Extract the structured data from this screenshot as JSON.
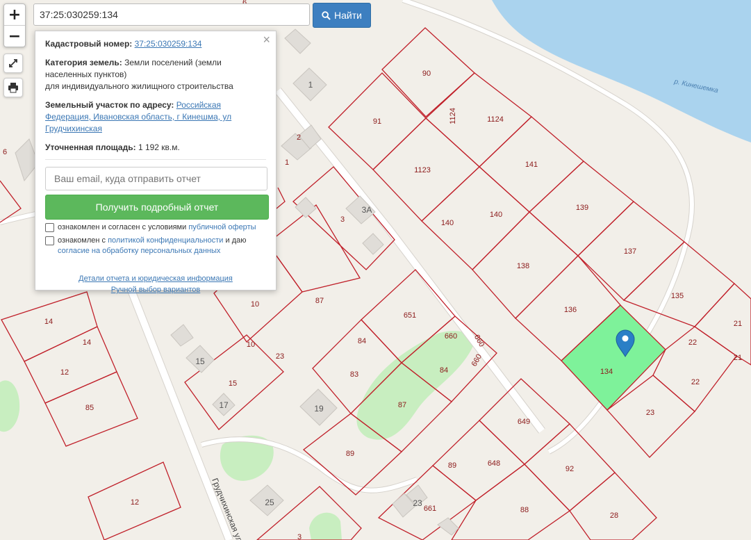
{
  "search": {
    "value": "37:25:030259:134",
    "button_label": "Найти"
  },
  "zoom": {
    "in_label": "+",
    "out_label": "−"
  },
  "popup": {
    "cadastral_label": "Кадастровый номер:",
    "cadastral_value": "37:25:030259:134",
    "category_label": "Категория земель:",
    "category_value_1": "Земли поселений (земли",
    "category_value_2": "населенных пунктов)",
    "category_value_3": "для индивидуального жилищного строительства",
    "address_label": "Земельный участок по адресу:",
    "address_value_1": "Российская",
    "address_value_2": "Федерация, Ивановская область, г Кинешма, ул",
    "address_value_3": "Грудчихинская",
    "area_label": "Уточненная площадь:",
    "area_value": "1 192 кв.м.",
    "email_placeholder": "Ваш email, куда отправить отчет",
    "report_button": "Получить подробный отчет",
    "consent1_pre": "ознакомлен и согласен с условиями",
    "consent1_link": "публичной оферты",
    "consent2_pre": "ознакомлен с",
    "consent2_link": "политикой конфиденциальности",
    "consent2_mid": "и даю",
    "consent2_link2": "согласие на обработку персональных данных",
    "details_link": "Детали отчета и юридическая информация",
    "manual_link": "Ручной выбор вариантов",
    "close_glyph": "×"
  },
  "map": {
    "river_label": "р. Кинешемка",
    "street_label": "Грудчихинская ул.",
    "selected_parcel": "134",
    "colors": {
      "selected": "#7ef29a",
      "parcel_stroke": "#c0202a",
      "water": "#aad3ee",
      "green": "#c8eec0"
    },
    "parcel_labels": [
      "90",
      "91",
      "1124",
      "1124",
      "1123",
      "141",
      "139",
      "140",
      "140",
      "137",
      "138",
      "136",
      "135",
      "134",
      "22",
      "22",
      "21",
      "21",
      "23",
      "651",
      "660",
      "660",
      "660",
      "84",
      "84",
      "83",
      "87",
      "87",
      "23",
      "10",
      "10",
      "15",
      "14",
      "14",
      "12",
      "85",
      "89",
      "89",
      "648",
      "649",
      "92",
      "88",
      "661",
      "28",
      "12",
      "3",
      "3",
      "2",
      "1",
      "6"
    ],
    "house_numbers": [
      "1",
      "3",
      "3А",
      "15",
      "17",
      "19",
      "25",
      "23"
    ],
    "icons": {
      "marker": "map-pin-icon",
      "fullscreen": "expand-icon",
      "print": "printer-icon",
      "search": "search-icon"
    }
  }
}
